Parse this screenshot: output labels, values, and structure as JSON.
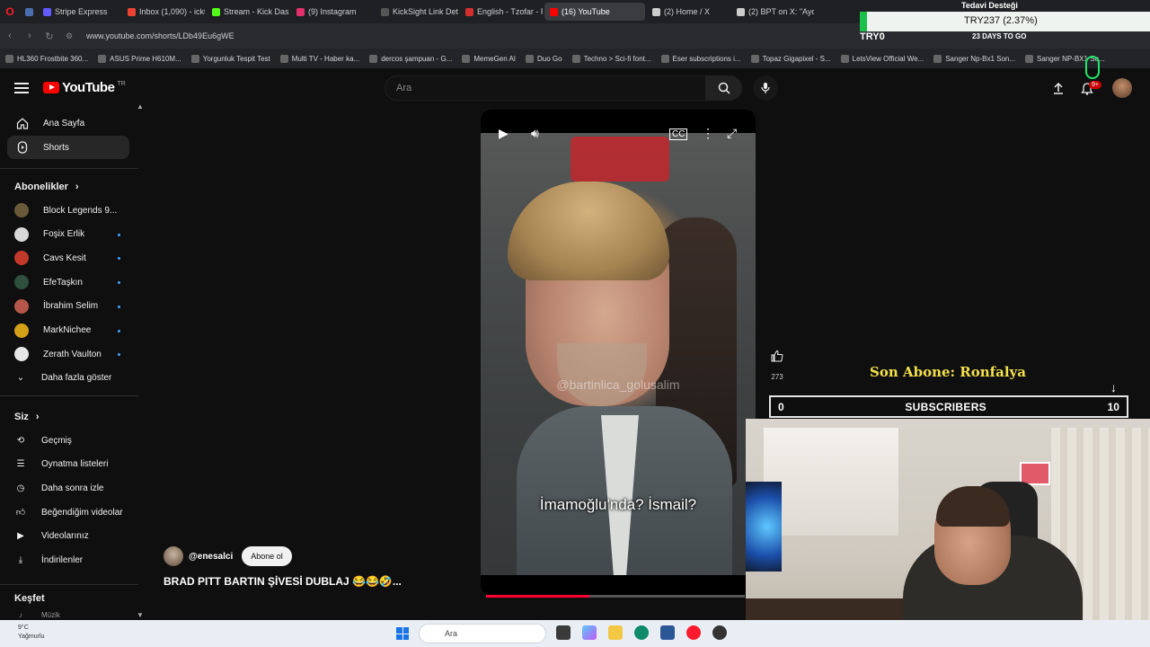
{
  "browser": {
    "tabs": [
      {
        "label": "Stripe Express",
        "color": "#635bff",
        "active": false
      },
      {
        "label": "Inbox (1,090) - ickta",
        "color": "#ea4335",
        "active": false
      },
      {
        "label": "Stream - Kick Dashb",
        "color": "#53fc18",
        "active": false
      },
      {
        "label": "(9) Instagram",
        "color": "#e1306c",
        "active": false
      },
      {
        "label": "KickSight Link Detec",
        "color": "#555555",
        "active": false
      },
      {
        "label": "English - Tzofar - Re",
        "color": "#d32f2f",
        "active": false
      },
      {
        "label": "(16) YouTube",
        "color": "#ff0000",
        "active": true
      },
      {
        "label": "(2) Home / X",
        "color": "#cccccc",
        "active": false
      },
      {
        "label": "(2) BPT on X: \"Aydın",
        "color": "#cccccc",
        "active": false
      }
    ],
    "url": "www.youtube.com/shorts/LDb49Eu6gWE",
    "bookmarks": [
      "HL360 Frostbite 360...",
      "ASUS Prime H610M...",
      "Yorgunluk Tespit Test",
      "Multi TV - Haber ka...",
      "dercos şampuan - G...",
      "MemeGen AI",
      "Duo Go",
      "Techno > Sci-fi font...",
      "Eser subscriptions i...",
      "Topaz Gigapixel - S...",
      "LetsView Official We...",
      "Sanger Np-Bx1 Son...",
      "Sanger NP-BX1 So..."
    ]
  },
  "header": {
    "logo_text": "YouTube",
    "logo_region": "TR",
    "search_placeholder": "Ara",
    "notification_count": "9+"
  },
  "sidebar": {
    "main": [
      {
        "label": "Ana Sayfa",
        "icon": "home-icon"
      },
      {
        "label": "Shorts",
        "icon": "shorts-icon"
      }
    ],
    "subscriptions_title": "Abonelikler",
    "subscriptions": [
      {
        "label": "Block Legends 9...",
        "color": "#6a5a3a"
      },
      {
        "label": "Foşix Erlik",
        "color": "#d8d8d8"
      },
      {
        "label": "Cavs Kesit",
        "color": "#c0392b"
      },
      {
        "label": "EfeTaşkın",
        "color": "#2f4f3f"
      },
      {
        "label": "İbrahim Selim",
        "color": "#b5564a"
      },
      {
        "label": "MarkNichee",
        "color": "#d4a017"
      },
      {
        "label": "Zerath Vaulton",
        "color": "#e6e6e6"
      }
    ],
    "show_more": "Daha fazla göster",
    "you_title": "Siz",
    "you_items": [
      {
        "label": "Geçmiş",
        "icon": "history-icon"
      },
      {
        "label": "Oynatma listeleri",
        "icon": "playlist-icon"
      },
      {
        "label": "Daha sonra izle",
        "icon": "clock-icon"
      },
      {
        "label": "Beğendiğim videolar",
        "icon": "thumbs-up-icon"
      },
      {
        "label": "Videolarınız",
        "icon": "video-icon"
      },
      {
        "label": "İndirilenler",
        "icon": "download-icon"
      }
    ],
    "explore_title": "Keşfet",
    "explore_partial": "Müzik"
  },
  "short": {
    "watermark": "@bartinlica_golusalim",
    "subtitle": "İmamoğlu'nda? İsmail?",
    "progress": 0.4,
    "like_count": "273",
    "channel": "@enesalci",
    "subscribe_label": "Abone ol",
    "title": "BRAD PITT BARTIN ŞİVESİ DUBLAJ 😂😂🤣..."
  },
  "overlay": {
    "ticker": "TRY237 (2.37%)",
    "tedavi": "Tedavi Desteği",
    "try_label": "TRY0",
    "days": "23 DAYS TO GO",
    "son_abone": "Son Abone: Ronfalya",
    "sub_current": "0",
    "sub_label": "SUBSCRIBERS",
    "sub_goal": "10"
  },
  "taskbar": {
    "temp": "9°C",
    "weather": "Yağmurlu",
    "search": "Ara"
  }
}
